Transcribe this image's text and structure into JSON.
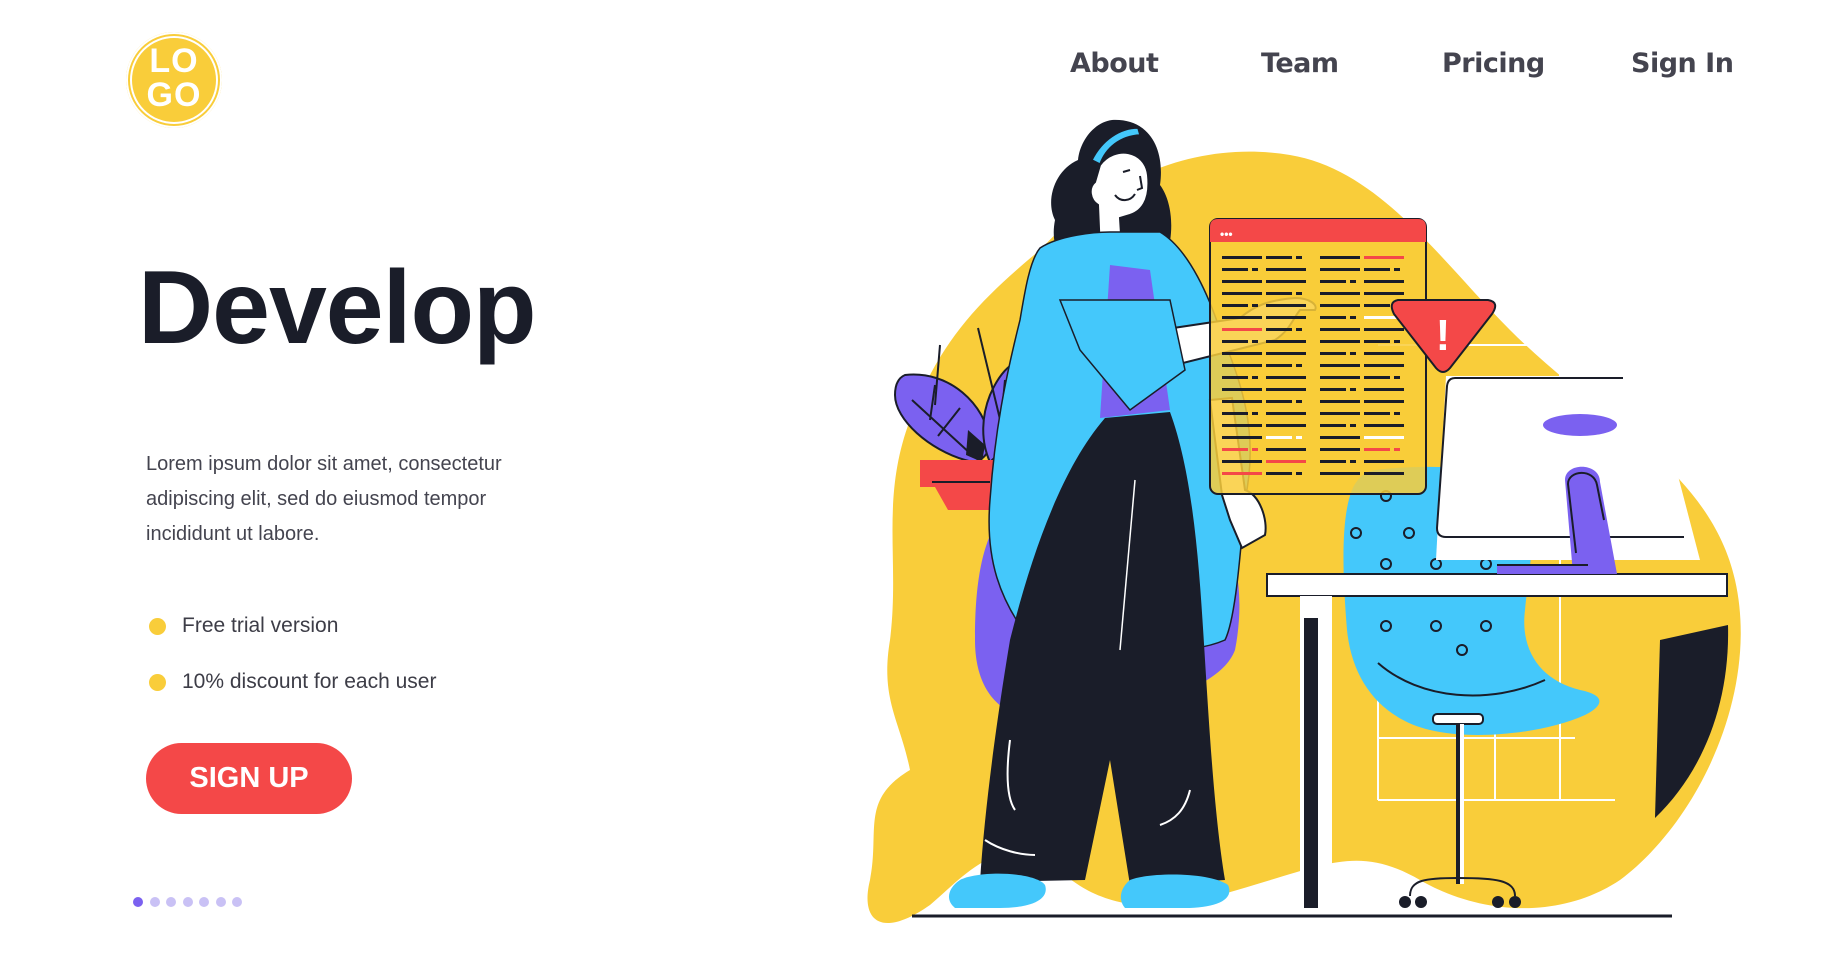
{
  "brand": {
    "logo_text_line1": "LO",
    "logo_text_line2": "GO",
    "logo_color": "#f9cd3a"
  },
  "nav": {
    "items": [
      {
        "label": "About"
      },
      {
        "label": "Team"
      },
      {
        "label": "Pricing"
      },
      {
        "label": "Sign In"
      }
    ]
  },
  "hero": {
    "title": "Develop",
    "description": "Lorem ipsum dolor sit amet, consectetur adipiscing elit, sed do eiusmod tempor incididunt ut labore.",
    "features": [
      {
        "text": "Free trial version"
      },
      {
        "text": "10% discount for each user"
      }
    ],
    "cta_label": "SIGN UP",
    "pagination": {
      "total": 7,
      "active_index": 0
    }
  },
  "illustration": {
    "alert_symbol": "!",
    "window_dots": "•••"
  },
  "colors": {
    "accent_yellow": "#f9cd3a",
    "accent_red": "#f44848",
    "accent_blue": "#44c8fb",
    "accent_purple": "#7b61f0",
    "text_dark": "#1a1d29"
  }
}
